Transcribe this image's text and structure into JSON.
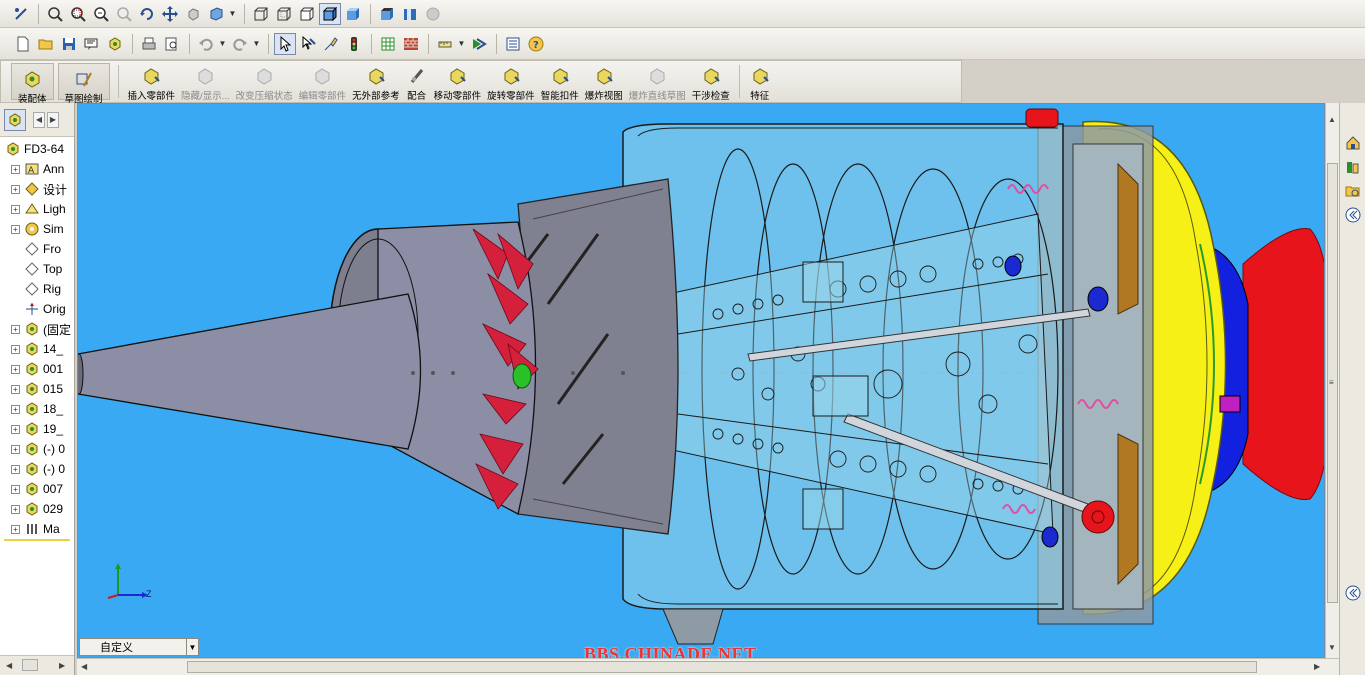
{
  "toolbar_view": {
    "buttons": [
      "sketch-select-icon",
      "zoom-fit-icon",
      "zoom-area-icon",
      "zoom-in-out-icon",
      "zoom-selection-icon",
      "rotate-icon",
      "pan-icon",
      "3d-view-icon",
      "view-orientation-icon",
      "wireframe-icon",
      "hidden-lines-visible-icon",
      "hidden-lines-removed-icon",
      "shaded-with-edges-icon",
      "shaded-icon",
      "section-view-icon",
      "realview-icon",
      "shadows-icon"
    ]
  },
  "toolbar_standard": {
    "buttons": [
      "new-icon",
      "open-icon",
      "save-icon",
      "print-preview-icon",
      "options-icon",
      "print-icon",
      "undo-icon",
      "redo-icon",
      "select-icon",
      "rebuild-icon",
      "traffic-light-icon",
      "grid-icon",
      "wall-icon",
      "measure-icon",
      "layers-icon",
      "customize-icon",
      "help-icon"
    ]
  },
  "command_manager": {
    "items": [
      {
        "label": "装配体",
        "icon": "assembly-icon",
        "disabled": false,
        "tab": true
      },
      {
        "label": "草图绘制",
        "icon": "sketch-icon",
        "disabled": false,
        "tab": true
      },
      {
        "label": "插入零部件",
        "icon": "insert-component-icon",
        "disabled": false
      },
      {
        "label": "隐藏/显示...",
        "icon": "hide-show-icon",
        "disabled": true
      },
      {
        "label": "改变压缩状态",
        "icon": "suppress-icon",
        "disabled": true
      },
      {
        "label": "编辑零部件",
        "icon": "edit-component-icon",
        "disabled": true
      },
      {
        "label": "无外部参考",
        "icon": "no-external-refs-icon",
        "disabled": false
      },
      {
        "label": "配合",
        "icon": "mate-icon",
        "disabled": false
      },
      {
        "label": "移动零部件",
        "icon": "move-component-icon",
        "disabled": false
      },
      {
        "label": "旋转零部件",
        "icon": "rotate-component-icon",
        "disabled": false
      },
      {
        "label": "智能扣件",
        "icon": "smart-fasteners-icon",
        "disabled": false
      },
      {
        "label": "爆炸视图",
        "icon": "exploded-view-icon",
        "disabled": false
      },
      {
        "label": "爆炸直线草图",
        "icon": "explode-line-sketch-icon",
        "disabled": true
      },
      {
        "label": "干涉检查",
        "icon": "interference-check-icon",
        "disabled": false
      },
      {
        "label": "特征",
        "icon": "features-icon",
        "disabled": false
      }
    ]
  },
  "feature_tree": {
    "items": [
      {
        "label": "FD3-64",
        "icon": "assembly-icon",
        "expander": "none",
        "indent": 0
      },
      {
        "label": "Ann",
        "icon": "annotations-icon",
        "expander": "+",
        "indent": 1
      },
      {
        "label": "设计",
        "icon": "design-binder-icon",
        "expander": "+",
        "indent": 1
      },
      {
        "label": "Ligh",
        "icon": "lights-icon",
        "expander": "+",
        "indent": 1
      },
      {
        "label": "Sim",
        "icon": "simulation-icon",
        "expander": "+",
        "indent": 1
      },
      {
        "label": "Fro",
        "icon": "plane-icon",
        "expander": "none",
        "indent": 1
      },
      {
        "label": "Top",
        "icon": "plane-icon",
        "expander": "none",
        "indent": 1
      },
      {
        "label": "Rig",
        "icon": "plane-icon",
        "expander": "none",
        "indent": 1
      },
      {
        "label": "Orig",
        "icon": "origin-icon",
        "expander": "none",
        "indent": 1
      },
      {
        "label": "(固定",
        "icon": "part-icon",
        "expander": "+",
        "indent": 1
      },
      {
        "label": "14_",
        "icon": "part-icon",
        "expander": "+",
        "indent": 1
      },
      {
        "label": "001",
        "icon": "part-icon",
        "expander": "+",
        "indent": 1
      },
      {
        "label": "015",
        "icon": "part-icon",
        "expander": "+",
        "indent": 1
      },
      {
        "label": "18_",
        "icon": "part-icon",
        "expander": "+",
        "indent": 1
      },
      {
        "label": "19_",
        "icon": "part-icon",
        "expander": "+",
        "indent": 1
      },
      {
        "label": "(-) 0",
        "icon": "part-icon",
        "expander": "+",
        "indent": 1
      },
      {
        "label": "(-) 0",
        "icon": "part-icon",
        "expander": "+",
        "indent": 1
      },
      {
        "label": "007",
        "icon": "part-icon",
        "expander": "+",
        "indent": 1
      },
      {
        "label": "029",
        "icon": "part-icon",
        "expander": "+",
        "indent": 1
      },
      {
        "label": "Ma",
        "icon": "mates-icon",
        "expander": "+",
        "indent": 1
      }
    ]
  },
  "viewport": {
    "background": "#38a9f2",
    "config_label": "自定义",
    "watermark": "BBS.CHINADE.NET",
    "triad_z_label": "Z"
  },
  "colors": {
    "engine_red": "#e8141c",
    "engine_yellow": "#f6f016",
    "engine_blue": "#1220e0",
    "cone_gray": "#8c8ea6",
    "glass": "#9bd5e8"
  }
}
